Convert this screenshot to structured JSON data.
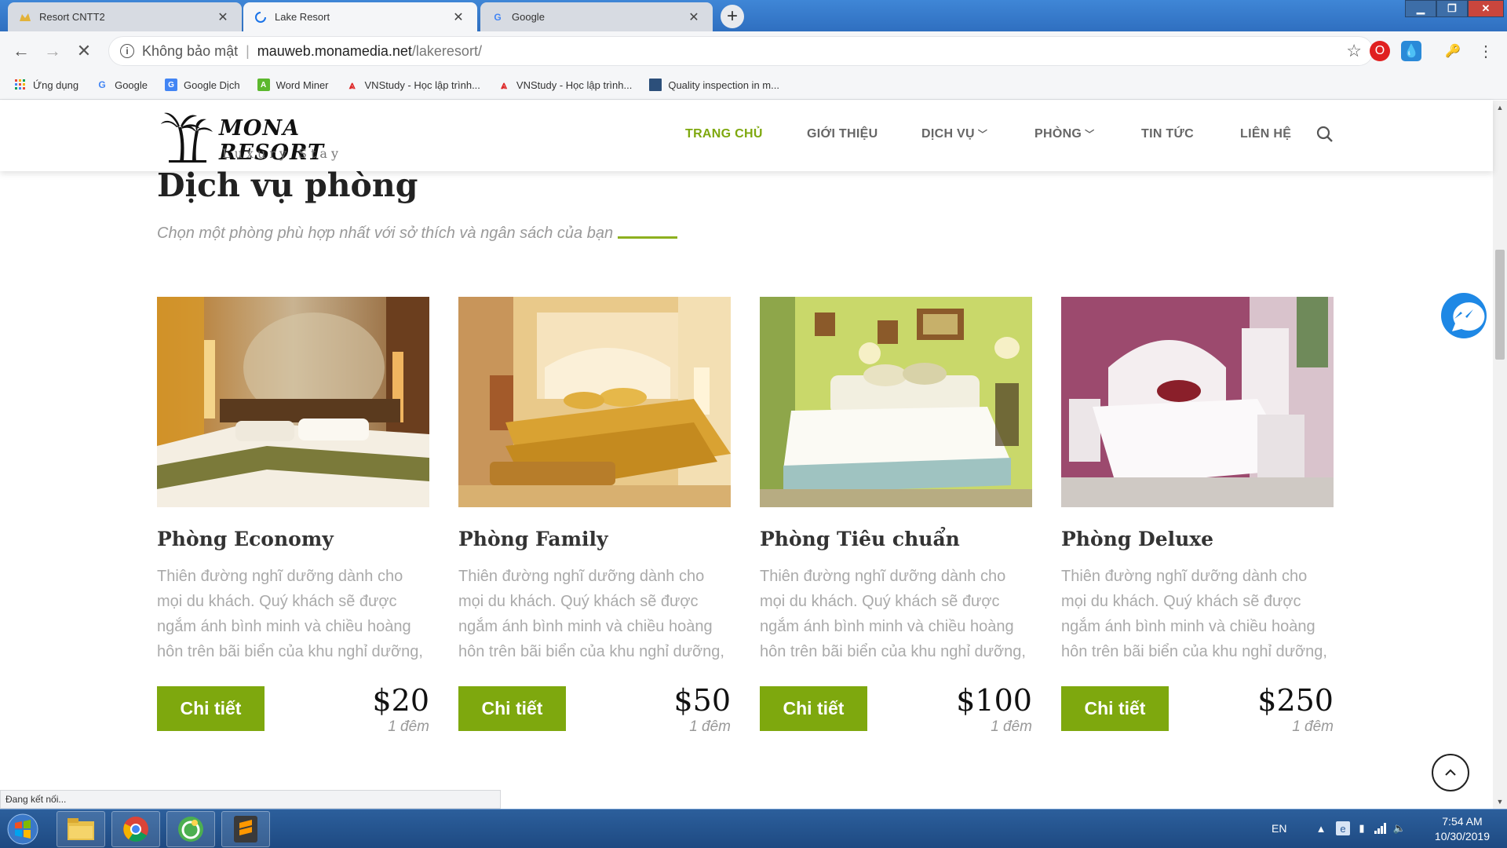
{
  "browser": {
    "tabs": [
      {
        "title": "Resort CNTT2",
        "icon": "resort-favicon"
      },
      {
        "title": "Lake Resort",
        "icon": "loading-spinner"
      },
      {
        "title": "Google",
        "icon": "google-favicon"
      }
    ],
    "address": {
      "security_label": "Không bảo mật",
      "host": "mauweb.monamedia.net",
      "path": "/lakeresort/"
    },
    "bookmarks": [
      {
        "label": "Ứng dụng",
        "icon": "apps-grid-icon"
      },
      {
        "label": "Google",
        "icon": "google-icon"
      },
      {
        "label": "Google Dịch",
        "icon": "translate-icon"
      },
      {
        "label": "Word Miner",
        "icon": "word-miner-icon"
      },
      {
        "label": "VNStudy - Học lập trình...",
        "icon": "vnstudy-icon"
      },
      {
        "label": "VNStudy - Học lập trình...",
        "icon": "vnstudy-icon"
      },
      {
        "label": "Quality inspection in m...",
        "icon": "document-icon"
      }
    ],
    "status_text": "Đang kết nối..."
  },
  "site": {
    "logo": {
      "name": "MONA RESORT",
      "tagline": "Luxury Stay"
    },
    "menu": [
      {
        "label": "TRANG CHỦ",
        "active": true,
        "dropdown": false
      },
      {
        "label": "GIỚI THIỆU",
        "active": false,
        "dropdown": false
      },
      {
        "label": "DỊCH VỤ",
        "active": false,
        "dropdown": true
      },
      {
        "label": "PHÒNG",
        "active": false,
        "dropdown": true
      },
      {
        "label": "TIN TỨC",
        "active": false,
        "dropdown": false
      },
      {
        "label": "LIÊN HỆ",
        "active": false,
        "dropdown": false
      }
    ],
    "accent_color": "#7ea80e"
  },
  "section": {
    "title": "Dịch vụ phòng",
    "subtitle": "Chọn một phòng phù hợp nhất với sở thích và ngân sách của bạn"
  },
  "rooms": [
    {
      "name": "Phòng Economy",
      "description": "Thiên đường nghĩ dưỡng dành cho mọi du khách. Quý khách sẽ được ngắm ánh bình minh và chiều hoàng hôn trên bãi biển của khu nghỉ dưỡng,",
      "button": "Chi tiết",
      "price": "$20",
      "per": "1 đêm"
    },
    {
      "name": "Phòng Family",
      "description": "Thiên đường nghĩ dưỡng dành cho mọi du khách. Quý khách sẽ được ngắm ánh bình minh và chiều hoàng hôn trên bãi biển của khu nghỉ dưỡng,",
      "button": "Chi tiết",
      "price": "$50",
      "per": "1 đêm"
    },
    {
      "name": "Phòng Tiêu chuẩn",
      "description": "Thiên đường nghĩ dưỡng dành cho mọi du khách. Quý khách sẽ được ngắm ánh bình minh và chiều hoàng hôn trên bãi biển của khu nghỉ dưỡng,",
      "button": "Chi tiết",
      "price": "$100",
      "per": "1 đêm"
    },
    {
      "name": "Phòng Deluxe",
      "description": "Thiên đường nghĩ dưỡng dành cho mọi du khách. Quý khách sẽ được ngắm ánh bình minh và chiều hoàng hôn trên bãi biển của khu nghỉ dưỡng,",
      "button": "Chi tiết",
      "price": "$250",
      "per": "1 đêm"
    }
  ],
  "taskbar": {
    "apps": [
      "file-explorer-icon",
      "chrome-icon",
      "coccoc-icon",
      "sublime-text-icon"
    ],
    "language": "EN",
    "time": "7:54 AM",
    "date": "10/30/2019"
  }
}
